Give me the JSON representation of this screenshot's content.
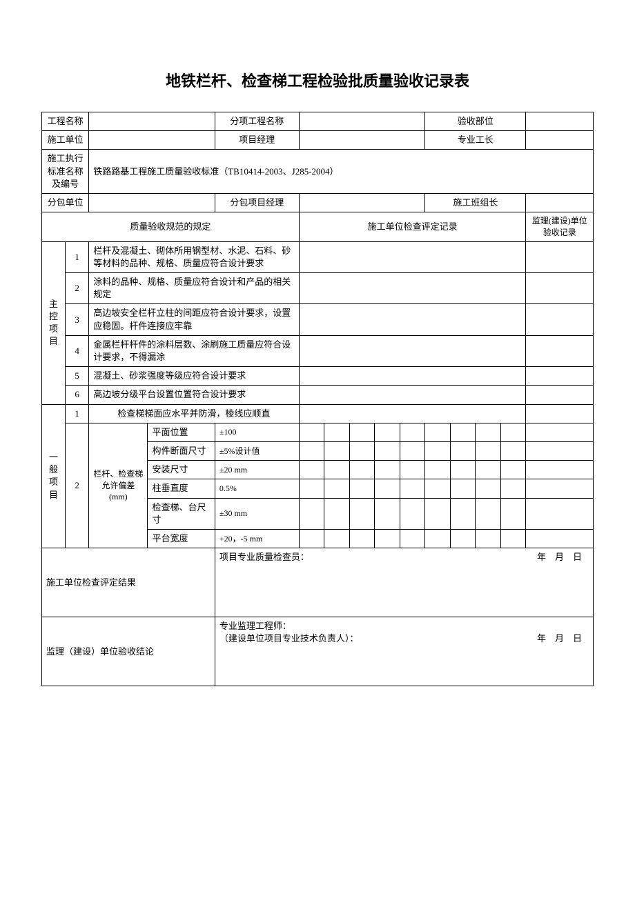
{
  "title": "地铁栏杆、检查梯工程检验批质量验收记录表",
  "header": {
    "project_name_label": "工程名称",
    "project_name_value": "",
    "subitem_label": "分项工程名称",
    "subitem_value": "",
    "accept_part_label": "验收部位",
    "accept_part_value": "",
    "construction_unit_label": "施工单位",
    "construction_unit_value": "",
    "project_manager_label": "项目经理",
    "project_manager_value": "",
    "pro_foreman_label": "专业工长",
    "pro_foreman_value": "",
    "exec_standard_label": "施工执行标准名称及编号",
    "exec_standard_value": "铁路路基工程施工质量验收标准（TB10414-2003、J285-2004）",
    "subcontract_unit_label": "分包单位",
    "subcontract_unit_value": "",
    "subcontract_pm_label": "分包项目经理",
    "subcontract_pm_value": "",
    "construction_team_leader_label": "施工班组长",
    "construction_team_leader_value": ""
  },
  "section_headers": {
    "spec": "质量验收规范的规定",
    "check_record": "施工单位检查评定记录",
    "supervise_record": "监理(建设)单位验收记录"
  },
  "main_items_label": "主控项目",
  "main_items": [
    {
      "num": "1",
      "text": "栏杆及混凝土、砌体所用钢型材、水泥、石料、砂等材料的品种、规格、质量应符合设计要求"
    },
    {
      "num": "2",
      "text": "涂料的品种、规格、质量应符合设计和产品的相关规定"
    },
    {
      "num": "3",
      "text": "高边坡安全栏杆立柱的间距应符合设计要求，设置应稳固。杆件连接应牢靠"
    },
    {
      "num": "4",
      "text": "金属栏杆杆件的涂料层数、涂刷施工质量应符合设计要求，不得漏涂"
    },
    {
      "num": "5",
      "text": "混凝土、砂浆强度等级应符合设计要求"
    },
    {
      "num": "6",
      "text": "高边坡分级平台设置位置符合设计要求"
    }
  ],
  "general_items_label": "一般项目",
  "general_item_1": {
    "num": "1",
    "text": "检查梯梯面应水平并防滑，棱线应顺直"
  },
  "general_item_2": {
    "num": "2",
    "label": "栏杆、检查梯允许偏差(mm)",
    "rows": [
      {
        "name": "平面位置",
        "tol": "±100"
      },
      {
        "name": "构件断面尺寸",
        "tol": "±5%设计值"
      },
      {
        "name": "安装尺寸",
        "tol": "±20 mm"
      },
      {
        "name": "柱垂直度",
        "tol": "0.5%"
      },
      {
        "name": "检查梯、台尺寸",
        "tol": "±30 mm"
      },
      {
        "name": "平台宽度",
        "tol": "+20，-5 mm"
      }
    ]
  },
  "footer": {
    "construction_result_label": "施工单位检查评定结果",
    "construction_inspector_label": "项目专业质量检查员：",
    "supervise_result_label": "监理（建设）单位验收结论",
    "supervise_engineer_label": "专业监理工程师：",
    "supervise_owner_label": "（建设单位项目专业技术负责人）：",
    "year": "年",
    "month": "月",
    "day": "日"
  }
}
